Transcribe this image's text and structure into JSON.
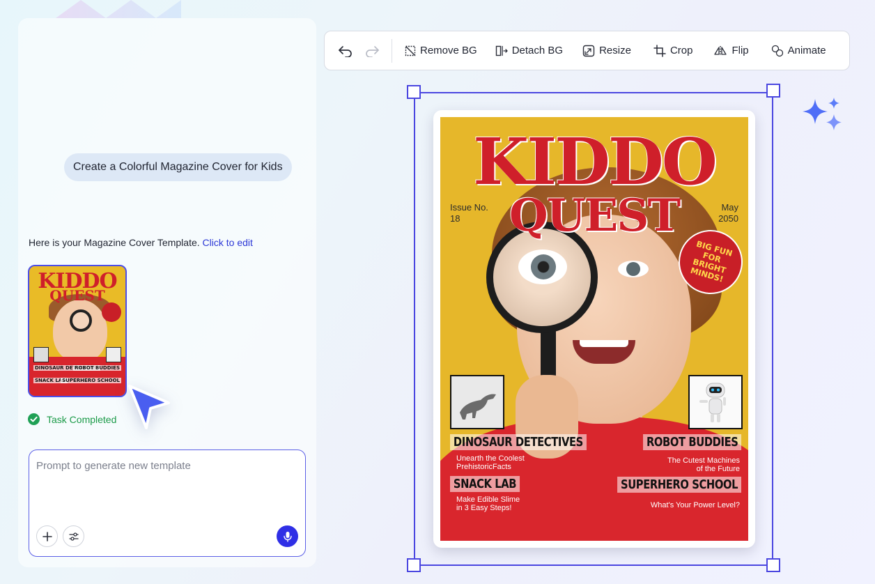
{
  "chat": {
    "user_message": "Create a Colorful Magazine Cover for Kids",
    "reply_text": "Here is your Magazine Cover Template.",
    "reply_link": "Click to edit",
    "status": "Task Completed"
  },
  "prompt": {
    "placeholder": "Prompt to generate new template",
    "value": ""
  },
  "toolbar": {
    "undo_icon": "undo-icon",
    "redo_icon": "redo-icon",
    "remove_bg": "Remove BG",
    "detach_bg": "Detach BG",
    "resize": "Resize",
    "crop": "Crop",
    "flip": "Flip",
    "animate": "Animate"
  },
  "cover": {
    "title_line1": "KIDDO",
    "title_line2": "QUEST",
    "issue_label": "Issue No.",
    "issue_number": "18",
    "month": "May",
    "year": "2050",
    "badge": "BIG FUN FOR BRIGHT MINDS!",
    "stories": [
      {
        "headline": "DINOSAUR DETECTIVES",
        "sub1": "Unearth the Coolest",
        "sub2": "PrehistoricFacts"
      },
      {
        "headline": "SNACK LAB",
        "sub1": "Make Edible Slime",
        "sub2": "in 3 Easy Steps!"
      },
      {
        "headline": "ROBOT BUDDIES",
        "sub1": "The Cutest Machines",
        "sub2": "of the Future"
      },
      {
        "headline": "SUPERHERO SCHOOL",
        "sub1": "What's Your Power Level?",
        "sub2": ""
      }
    ]
  },
  "thumbnail": {
    "title_line1": "KIDDO",
    "title_line2": "QUEST",
    "story1": "DINOSAUR DETECTIVES",
    "story2": "SNACK LAB",
    "story3": "ROBOT BUDDIES",
    "story4": "SUPERHERO SCHOOL"
  },
  "colors": {
    "accent": "#4a46e0",
    "success": "#1fa055",
    "cover_bg": "#e6b72a",
    "title_red": "#cf1f2a"
  }
}
